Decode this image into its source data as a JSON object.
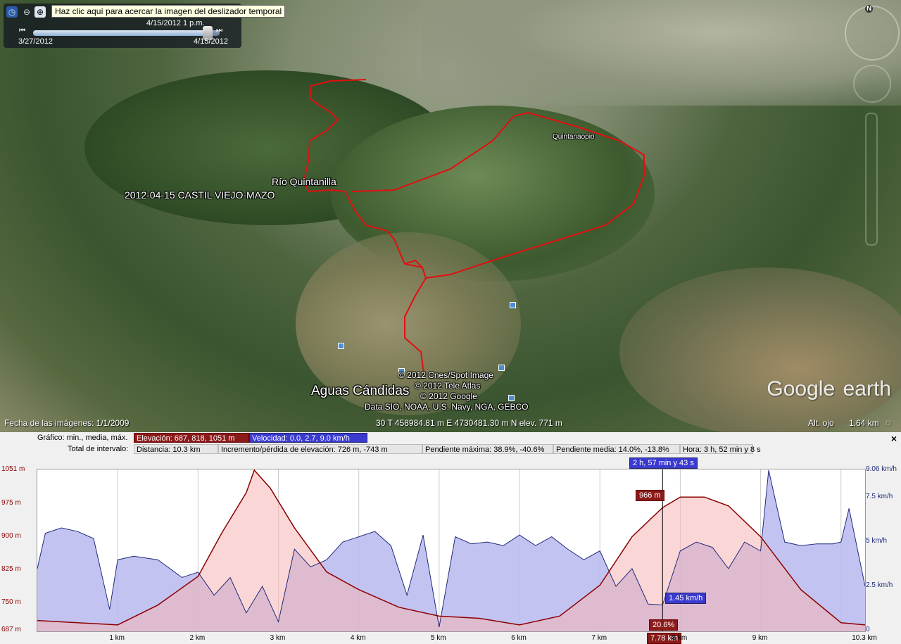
{
  "time_slider": {
    "tooltip": "Haz clic aquí para acercar la imagen del deslizador temporal",
    "current": "4/15/2012    1 p.m.",
    "start": "3/27/2012",
    "end": "4/15/2012",
    "fill_fraction": 0.96
  },
  "map": {
    "labels": {
      "river": "Río Quintanilla",
      "track": "2012-04-15 CASTIL VIEJO-MAZO",
      "place": "Quintanaopio",
      "town": "Aguas Cándidas"
    },
    "copyright": [
      "© 2012 Cnes/Spot Image",
      "© 2012 Tele Atlas",
      "© 2012 Google",
      "Data SIO, NOAA, U.S. Navy, NGA, GEBCO"
    ],
    "logo_word1": "Google",
    "logo_word2": "earth",
    "compass_n": "N"
  },
  "status": {
    "imagery_date": "Fecha de las imágenes: 1/1/2009",
    "coords": "30 T 458984.81 m E 4730481.30 m N elev.   771 m",
    "eye_alt_label": "Alt. ojo",
    "eye_alt": "1.64 km"
  },
  "profile": {
    "graph_label": "Gráfico: min., media, máx.",
    "elevation_stat": "Elevación: 687, 818, 1051 m",
    "speed_stat": "Velocidad: 0.0, 2.7, 9.0 km/h",
    "interval_label": "Total de intervalo:",
    "distance": "Distancia: 10.3 km",
    "gain_loss": "Incremento/pérdida de elevación: 726 m, -743 m",
    "max_slope": "Pendiente máxima: 38.9%, -40.6%",
    "avg_slope": "Pendiente media: 14.0%, -13.8%",
    "time": "Hora: 3 h, 52 min y 8 s",
    "close": "×",
    "cursor_time": "2 h, 57 min y 43 s",
    "cursor_elev": "966 m",
    "cursor_speed": "1.45 km/h",
    "cursor_slope": "20.6%",
    "cursor_dist": "7.78 km",
    "colors": {
      "elevation": "#8b0000",
      "speed": "#1f2a7a",
      "elev_fill": "#f5b5b5",
      "speed_fill": "#b8b8f0"
    }
  },
  "chart_data": {
    "type": "area",
    "xlabel": "",
    "ylabel": "",
    "x_ticks": [
      "1 km",
      "2 km",
      "3 km",
      "4 km",
      "5 km",
      "6 km",
      "7 km",
      "8 km",
      "9 km",
      "10.3 km"
    ],
    "y_ticks_left": [
      "1051 m",
      "975 m",
      "900 m",
      "825 m",
      "750 m",
      "687 m"
    ],
    "y_ticks_right": [
      "9.06 km/h",
      "7.5 km/h",
      "5 km/h",
      "2.5 km/h",
      "0"
    ],
    "xlim": [
      0,
      10.3
    ],
    "ylim_left": [
      687,
      1051
    ],
    "ylim_right": [
      0,
      9.06
    ],
    "cursor_x": 7.78,
    "series": [
      {
        "name": "Elevación",
        "x": [
          0,
          0.5,
          1.0,
          1.5,
          2.0,
          2.3,
          2.6,
          2.7,
          2.9,
          3.2,
          3.6,
          4.0,
          4.5,
          5.0,
          5.5,
          6.0,
          6.5,
          7.0,
          7.4,
          7.78,
          8.0,
          8.3,
          8.6,
          9.0,
          9.5,
          10.0,
          10.3
        ],
        "values": [
          710,
          705,
          700,
          745,
          810,
          910,
          1000,
          1051,
          1010,
          920,
          820,
          780,
          740,
          720,
          715,
          700,
          720,
          790,
          900,
          966,
          990,
          990,
          970,
          900,
          780,
          705,
          700
        ]
      },
      {
        "name": "Velocidad",
        "x": [
          0,
          0.1,
          0.3,
          0.5,
          0.7,
          0.9,
          1.0,
          1.2,
          1.5,
          1.8,
          2.0,
          2.2,
          2.4,
          2.6,
          2.8,
          3.0,
          3.2,
          3.4,
          3.6,
          3.8,
          4.0,
          4.2,
          4.4,
          4.6,
          4.8,
          5.0,
          5.2,
          5.4,
          5.6,
          5.8,
          6.0,
          6.2,
          6.4,
          6.6,
          6.8,
          7.0,
          7.2,
          7.4,
          7.6,
          7.78,
          8.0,
          8.2,
          8.4,
          8.6,
          8.8,
          9.0,
          9.1,
          9.3,
          9.5,
          9.7,
          9.9,
          10.0,
          10.1,
          10.3
        ],
        "values": [
          3.5,
          5.5,
          5.8,
          5.6,
          5.2,
          1.2,
          4.0,
          4.2,
          4.0,
          3.0,
          3.3,
          2.0,
          3.0,
          1.0,
          2.5,
          0.5,
          4.6,
          3.6,
          4.0,
          5.0,
          5.3,
          5.6,
          4.8,
          2.0,
          5.4,
          0.2,
          5.3,
          4.9,
          5.0,
          4.8,
          5.4,
          4.8,
          5.3,
          4.6,
          4.0,
          4.5,
          2.5,
          3.5,
          1.5,
          1.45,
          4.5,
          5.0,
          4.7,
          3.5,
          5.0,
          4.5,
          9.06,
          5.0,
          4.8,
          4.9,
          4.9,
          5.0,
          6.9,
          2.5
        ]
      }
    ]
  }
}
